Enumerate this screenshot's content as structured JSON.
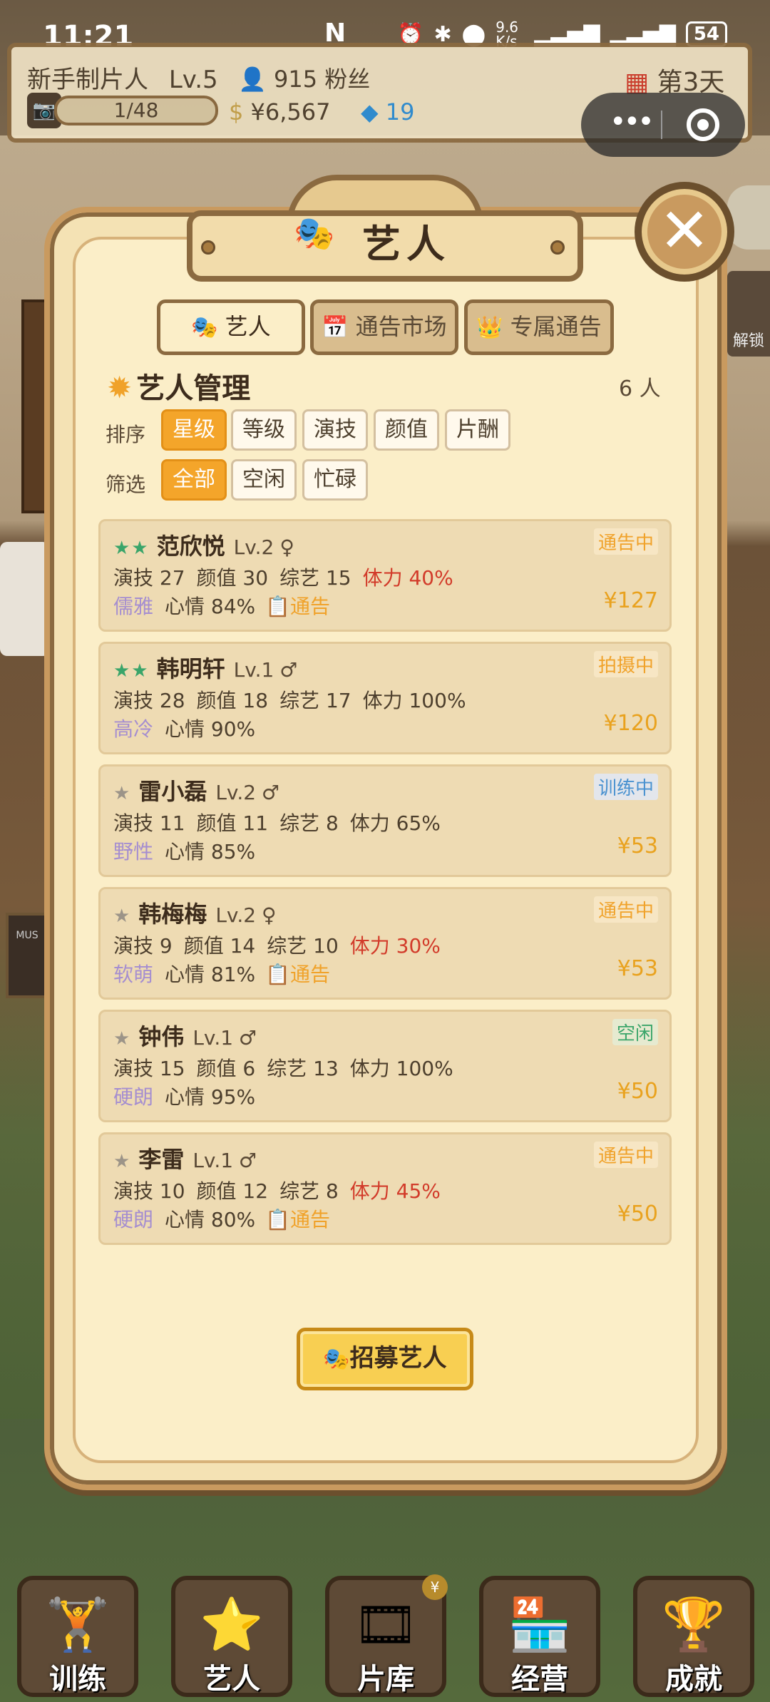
{
  "status_bar": {
    "time": "11:21",
    "nfc": "N",
    "speed": "9.6 K/s",
    "battery": "54"
  },
  "hud": {
    "player_title": "新手制片人",
    "level": "Lv.5",
    "fans": "915 粉丝",
    "exp": "1/48",
    "money": "¥6,567",
    "gems": "19",
    "day": "第3天"
  },
  "side": {
    "unlock": "解锁"
  },
  "panel": {
    "title": "艺人",
    "tabs": [
      {
        "label": "艺人",
        "icon": "mask-icon"
      },
      {
        "label": "通告市场",
        "icon": "calendar-icon"
      },
      {
        "label": "专属通告",
        "icon": "crown-icon"
      }
    ],
    "section_title": "艺人管理",
    "count": "6 人",
    "sort_label": "排序",
    "sort_options": [
      "星级",
      "等级",
      "演技",
      "颜值",
      "片酬"
    ],
    "filter_label": "筛选",
    "filter_options": [
      "全部",
      "空闲",
      "忙碌"
    ],
    "recruit": "招募艺人"
  },
  "artists": [
    {
      "stars": "★★",
      "name": "范欣悦",
      "level": "Lv.2",
      "gender": "♀",
      "status": "通告中",
      "acting": "演技 27",
      "looks": "颜值 30",
      "variety": "综艺 15",
      "stamina": "体力 40%",
      "trait": "儒雅",
      "mood": "心情 84%",
      "notice": "通告",
      "pay": "¥127"
    },
    {
      "stars": "★★",
      "name": "韩明轩",
      "level": "Lv.1",
      "gender": "♂",
      "status": "拍摄中",
      "acting": "演技 28",
      "looks": "颜值 18",
      "variety": "综艺 17",
      "stamina": "体力 100%",
      "trait": "高冷",
      "mood": "心情 90%",
      "notice": "",
      "pay": "¥120"
    },
    {
      "stars": "★",
      "name": "雷小磊",
      "level": "Lv.2",
      "gender": "♂",
      "status": "训练中",
      "acting": "演技 11",
      "looks": "颜值 11",
      "variety": "综艺 8",
      "stamina": "体力 65%",
      "trait": "野性",
      "mood": "心情 85%",
      "notice": "",
      "pay": "¥53"
    },
    {
      "stars": "★",
      "name": "韩梅梅",
      "level": "Lv.2",
      "gender": "♀",
      "status": "通告中",
      "acting": "演技 9",
      "looks": "颜值 14",
      "variety": "综艺 10",
      "stamina": "体力 30%",
      "trait": "软萌",
      "mood": "心情 81%",
      "notice": "通告",
      "pay": "¥53"
    },
    {
      "stars": "★",
      "name": "钟伟",
      "level": "Lv.1",
      "gender": "♂",
      "status": "空闲",
      "acting": "演技 15",
      "looks": "颜值 6",
      "variety": "综艺 13",
      "stamina": "体力 100%",
      "trait": "硬朗",
      "mood": "心情 95%",
      "notice": "",
      "pay": "¥50"
    },
    {
      "stars": "★",
      "name": "李雷",
      "level": "Lv.1",
      "gender": "♂",
      "status": "通告中",
      "acting": "演技 10",
      "looks": "颜值 12",
      "variety": "综艺 8",
      "stamina": "体力 45%",
      "trait": "硬朗",
      "mood": "心情 80%",
      "notice": "通告",
      "pay": "¥50"
    }
  ],
  "nav": [
    {
      "label": "训练",
      "icon": "dumbbell-icon"
    },
    {
      "label": "艺人",
      "icon": "star-trophy-icon"
    },
    {
      "label": "片库",
      "icon": "film-reel-icon",
      "badge": "¥"
    },
    {
      "label": "经营",
      "icon": "shop-icon"
    },
    {
      "label": "成就",
      "icon": "trophy-icon"
    }
  ],
  "colors": {
    "accent": "#f4a52a",
    "low_stamina": "#d23b2a",
    "panel_bg": "#fbeec8",
    "frame": "#8b6a40"
  }
}
